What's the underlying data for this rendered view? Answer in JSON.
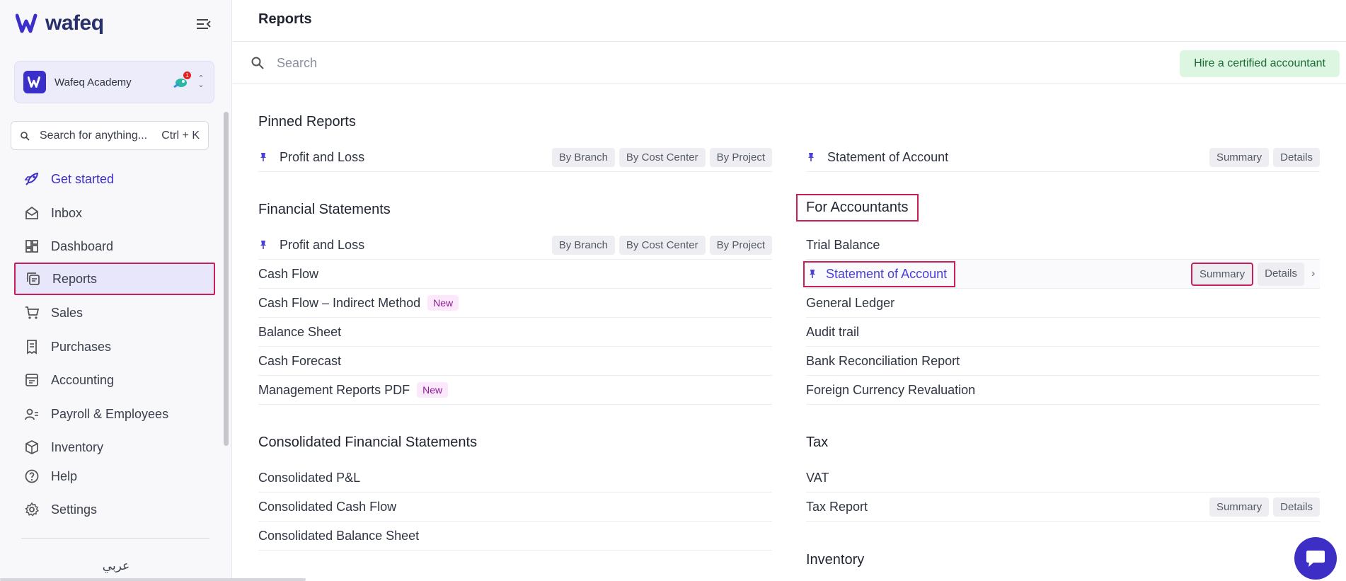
{
  "app": {
    "brand": "wafeq"
  },
  "org": {
    "name": "Wafeq Academy",
    "notification_count": "1"
  },
  "side_search": {
    "placeholder": "Search for anything...",
    "shortcut": "Ctrl + K"
  },
  "nav": [
    {
      "key": "get-started",
      "label": "Get started",
      "icon": "rocket-icon"
    },
    {
      "key": "inbox",
      "label": "Inbox",
      "icon": "envelope-icon"
    },
    {
      "key": "dashboard",
      "label": "Dashboard",
      "icon": "dashboard-icon"
    },
    {
      "key": "reports",
      "label": "Reports",
      "icon": "reports-icon"
    },
    {
      "key": "sales",
      "label": "Sales",
      "icon": "cart-icon"
    },
    {
      "key": "purchases",
      "label": "Purchases",
      "icon": "receipt-icon"
    },
    {
      "key": "accounting",
      "label": "Accounting",
      "icon": "ledger-icon"
    },
    {
      "key": "payroll",
      "label": "Payroll & Employees",
      "icon": "users-icon"
    },
    {
      "key": "inventory",
      "label": "Inventory",
      "icon": "box-icon"
    },
    {
      "key": "help",
      "label": "Help",
      "icon": "help-icon"
    },
    {
      "key": "settings",
      "label": "Settings",
      "icon": "gear-icon"
    }
  ],
  "language_link": "عربي",
  "page": {
    "title": "Reports"
  },
  "search": {
    "placeholder": "Search"
  },
  "hire_button": "Hire a certified accountant",
  "sections": {
    "pinned": {
      "title": "Pinned Reports",
      "left": {
        "label": "Profit and Loss",
        "tags": [
          "By Branch",
          "By Cost Center",
          "By Project"
        ]
      },
      "right": {
        "label": "Statement of Account",
        "tags": [
          "Summary",
          "Details"
        ]
      }
    },
    "financial": {
      "title": "Financial Statements",
      "items": [
        {
          "label": "Profit and Loss",
          "tags": [
            "By Branch",
            "By Cost Center",
            "By Project"
          ]
        },
        {
          "label": "Cash Flow"
        },
        {
          "label": "Cash Flow – Indirect Method",
          "badge": "New"
        },
        {
          "label": "Balance Sheet"
        },
        {
          "label": "Cash Forecast"
        },
        {
          "label": "Management Reports PDF",
          "badge": "New"
        }
      ]
    },
    "accountants": {
      "title": "For Accountants",
      "items": [
        {
          "label": "Trial Balance"
        },
        {
          "label": "Statement of Account",
          "tags": [
            "Summary",
            "Details"
          ]
        },
        {
          "label": "General Ledger"
        },
        {
          "label": "Audit trail"
        },
        {
          "label": "Bank Reconciliation Report"
        },
        {
          "label": "Foreign Currency Revaluation"
        }
      ]
    },
    "consolidated": {
      "title": "Consolidated Financial Statements",
      "items": [
        {
          "label": "Consolidated P&L"
        },
        {
          "label": "Consolidated Cash Flow"
        },
        {
          "label": "Consolidated Balance Sheet"
        }
      ]
    },
    "tax": {
      "title": "Tax",
      "items": [
        {
          "label": "VAT"
        },
        {
          "label": "Tax Report",
          "tags": [
            "Summary",
            "Details"
          ]
        }
      ]
    },
    "inventory": {
      "title": "Inventory"
    }
  },
  "colors": {
    "accent": "#3b2fc9",
    "highlight_box": "#c81f5a",
    "hire_bg": "#dcf6e2",
    "new_badge_bg": "#fbe8fa"
  }
}
